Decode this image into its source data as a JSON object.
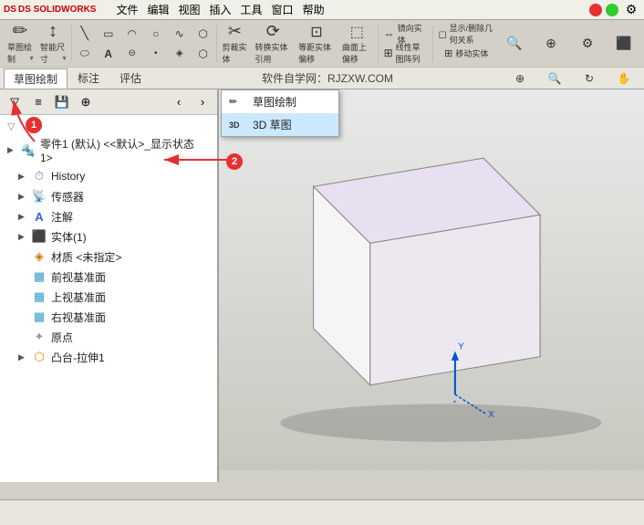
{
  "app": {
    "name": "SOLIDWORKS",
    "logo": "DS SOLIDWORKS"
  },
  "toolbar": {
    "row1_buttons": [
      {
        "id": "sketch",
        "icon": "✏",
        "label": "草图绘制"
      },
      {
        "id": "smart-dim",
        "icon": "↔",
        "label": "智能尺寸"
      },
      {
        "id": "line",
        "icon": "╲",
        "label": ""
      },
      {
        "id": "rect",
        "icon": "▭",
        "label": ""
      },
      {
        "id": "circle",
        "icon": "○",
        "label": ""
      },
      {
        "id": "arc",
        "icon": "◠",
        "label": ""
      },
      {
        "id": "polygon",
        "icon": "⬡",
        "label": ""
      },
      {
        "id": "trim",
        "icon": "✂",
        "label": "剪裁实体"
      },
      {
        "id": "convert",
        "icon": "⟳",
        "label": "转换实体引用"
      },
      {
        "id": "offset",
        "icon": "⊡",
        "label": "等距实体偏移"
      },
      {
        "id": "surface",
        "icon": "⬚",
        "label": "曲面上偏移"
      },
      {
        "id": "mirror",
        "icon": "⇔",
        "label": "镜向实体"
      },
      {
        "id": "lineararray",
        "icon": "⊞",
        "label": "线性草图阵列"
      },
      {
        "id": "show",
        "icon": "◻",
        "label": "显示/删除几何关系"
      }
    ],
    "row2_buttons": [
      {
        "id": "sketch2",
        "icon": "✏",
        "label": "草图绘制"
      },
      {
        "id": "dim2",
        "icon": "↔",
        "label": ""
      },
      {
        "id": "point",
        "icon": "⊕",
        "label": ""
      },
      {
        "id": "text",
        "icon": "A",
        "label": ""
      },
      {
        "id": "slot",
        "icon": "⊖",
        "label": ""
      },
      {
        "id": "spline",
        "icon": "~",
        "label": ""
      }
    ]
  },
  "tabs": [
    {
      "id": "sketch-tab",
      "label": "草图绘制",
      "active": true
    },
    {
      "id": "markup-tab",
      "label": "标注",
      "active": false
    },
    {
      "id": "eval-tab",
      "label": "评估",
      "active": false
    }
  ],
  "center_text": "软件自学网：RJZXW.COM",
  "panel_icons": [
    "▼",
    "≡",
    "💾",
    "⊕"
  ],
  "feature_tree": {
    "title": "零件1 (默认) <<默认>_显示状态 1>",
    "items": [
      {
        "id": "history",
        "label": "History",
        "icon": "⏱",
        "indent": 1,
        "hasArrow": true
      },
      {
        "id": "sensors",
        "label": "传感器",
        "icon": "📡",
        "indent": 1,
        "hasArrow": true
      },
      {
        "id": "annotations",
        "label": "注解",
        "icon": "A",
        "indent": 1,
        "hasArrow": true
      },
      {
        "id": "solid",
        "label": "实体(1)",
        "icon": "⬛",
        "indent": 1,
        "hasArrow": true
      },
      {
        "id": "material",
        "label": "材质 <未指定>",
        "icon": "◈",
        "indent": 1,
        "hasArrow": false
      },
      {
        "id": "front-plane",
        "label": "前视基准面",
        "icon": "▦",
        "indent": 1,
        "hasArrow": false
      },
      {
        "id": "top-plane",
        "label": "上视基准面",
        "icon": "▦",
        "indent": 1,
        "hasArrow": false
      },
      {
        "id": "right-plane",
        "label": "右视基准面",
        "icon": "▦",
        "indent": 1,
        "hasArrow": false
      },
      {
        "id": "origin",
        "label": "原点",
        "icon": "✦",
        "indent": 1,
        "hasArrow": false
      },
      {
        "id": "boss-extrude",
        "label": "凸台-拉伸1",
        "icon": "⬡",
        "indent": 1,
        "hasArrow": true
      }
    ]
  },
  "dropdown": {
    "items": [
      {
        "id": "sketch-draw",
        "label": "草图绘制",
        "icon": "✏"
      },
      {
        "id": "3d-sketch",
        "label": "3D 草图",
        "icon": "3D"
      }
    ]
  },
  "badges": {
    "badge1": "1",
    "badge2": "2"
  },
  "status_bar": {
    "text": ""
  }
}
